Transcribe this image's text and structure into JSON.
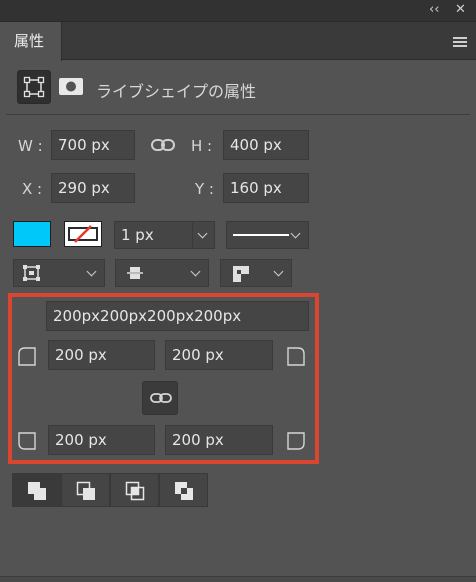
{
  "window": {
    "collapse_glyph": "‹‹",
    "close_glyph": "✕"
  },
  "tab": {
    "label": "属性"
  },
  "section": {
    "title": "ライブシェイプの属性"
  },
  "transform": {
    "w_label": "W :",
    "w_value": "700 px",
    "h_label": "H :",
    "h_value": "400 px",
    "x_label": "X :",
    "x_value": "290 px",
    "y_label": "Y :",
    "y_value": "160 px"
  },
  "appearance": {
    "fill_color": "#00c8f8",
    "stroke_width": "1 px"
  },
  "corners": {
    "all": "200px200px200px200px",
    "top_left": "200 px",
    "top_right": "200 px",
    "bottom_left": "200 px",
    "bottom_right": "200 px"
  },
  "highlight_color": "#d9452f",
  "icons": [
    "collapse-icon",
    "close-icon",
    "panel-menu-icon",
    "rect-shape-icon",
    "mask-icon",
    "link-icon",
    "align-icon",
    "stroke-align-icon",
    "corner-join-icon",
    "corner-radius-icon",
    "path-combine-icon",
    "path-subtract-icon",
    "path-intersect-icon",
    "path-exclude-icon"
  ]
}
